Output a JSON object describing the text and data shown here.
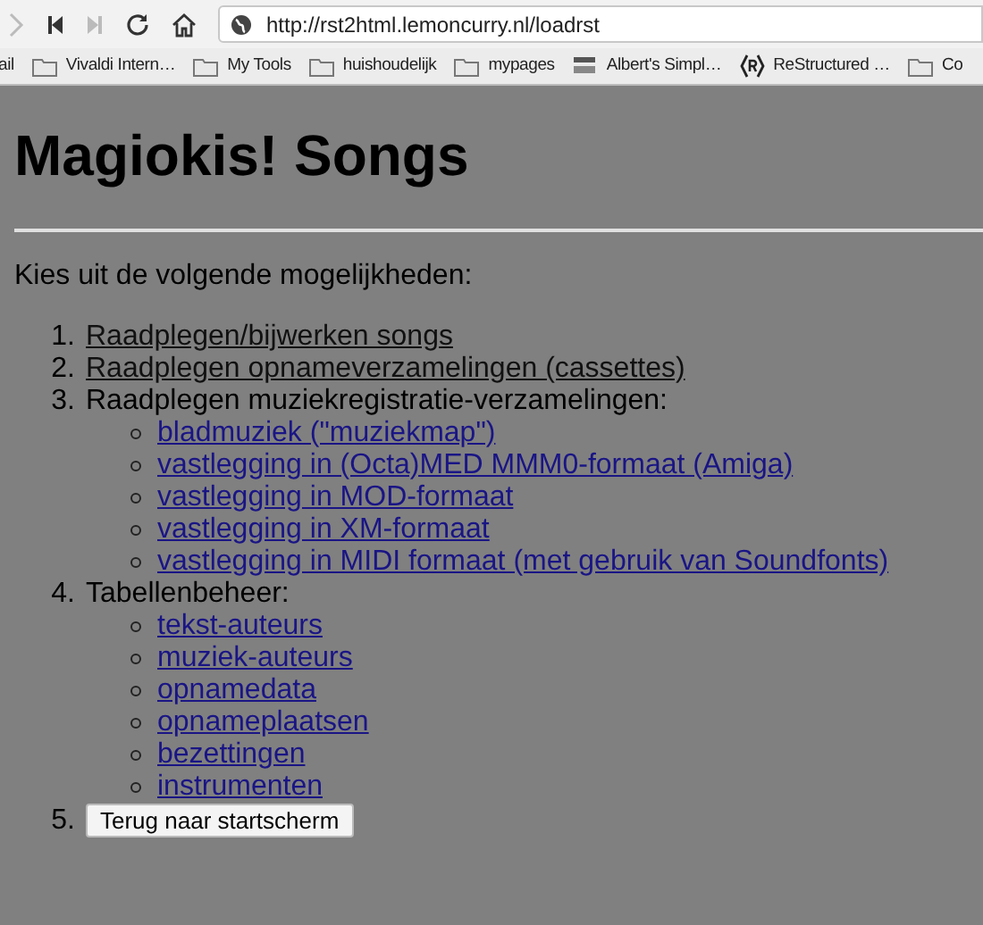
{
  "browser": {
    "url": "http://rst2html.lemoncurry.nl/loadrst",
    "bookmarks": [
      {
        "label": "ail",
        "kind": "plain"
      },
      {
        "label": "Vivaldi Intern…",
        "kind": "folder"
      },
      {
        "label": "My Tools",
        "kind": "folder"
      },
      {
        "label": "huishoudelijk",
        "kind": "folder"
      },
      {
        "label": "mypages",
        "kind": "folder"
      },
      {
        "label": "Albert's Simpl…",
        "kind": "logo"
      },
      {
        "label": "ReStructured …",
        "kind": "r"
      },
      {
        "label": "Co",
        "kind": "folder"
      }
    ]
  },
  "page": {
    "title": "Magiokis! Songs",
    "intro": "Kies uit de volgende mogelijkheden:",
    "items": [
      {
        "number": "1.",
        "kind": "link",
        "text": "Raadplegen/bijwerken songs",
        "visited": true
      },
      {
        "number": "2.",
        "kind": "link",
        "text": "Raadplegen opnameverzamelingen (cassettes)",
        "visited": true
      },
      {
        "number": "3.",
        "kind": "group",
        "text": "Raadplegen muziekregistratie-verzamelingen:",
        "children": [
          {
            "text": "bladmuziek (\"muziekmap\")",
            "visited": false
          },
          {
            "text": "vastlegging in (Octa)MED MMM0-formaat (Amiga)",
            "visited": false
          },
          {
            "text": "vastlegging in MOD-formaat",
            "visited": false
          },
          {
            "text": "vastlegging in XM-formaat",
            "visited": false
          },
          {
            "text": "vastlegging in MIDI formaat (met gebruik van Soundfonts)",
            "visited": false
          }
        ]
      },
      {
        "number": "4.",
        "kind": "group",
        "text": "Tabellenbeheer:",
        "children": [
          {
            "text": "tekst-auteurs",
            "visited": false
          },
          {
            "text": "muziek-auteurs",
            "visited": false
          },
          {
            "text": "opnamedata",
            "visited": false
          },
          {
            "text": "opnameplaatsen",
            "visited": false
          },
          {
            "text": "bezettingen",
            "visited": false
          },
          {
            "text": "instrumenten",
            "visited": false
          }
        ]
      },
      {
        "number": "5.",
        "kind": "button",
        "text": "Terug naar startscherm"
      }
    ]
  }
}
